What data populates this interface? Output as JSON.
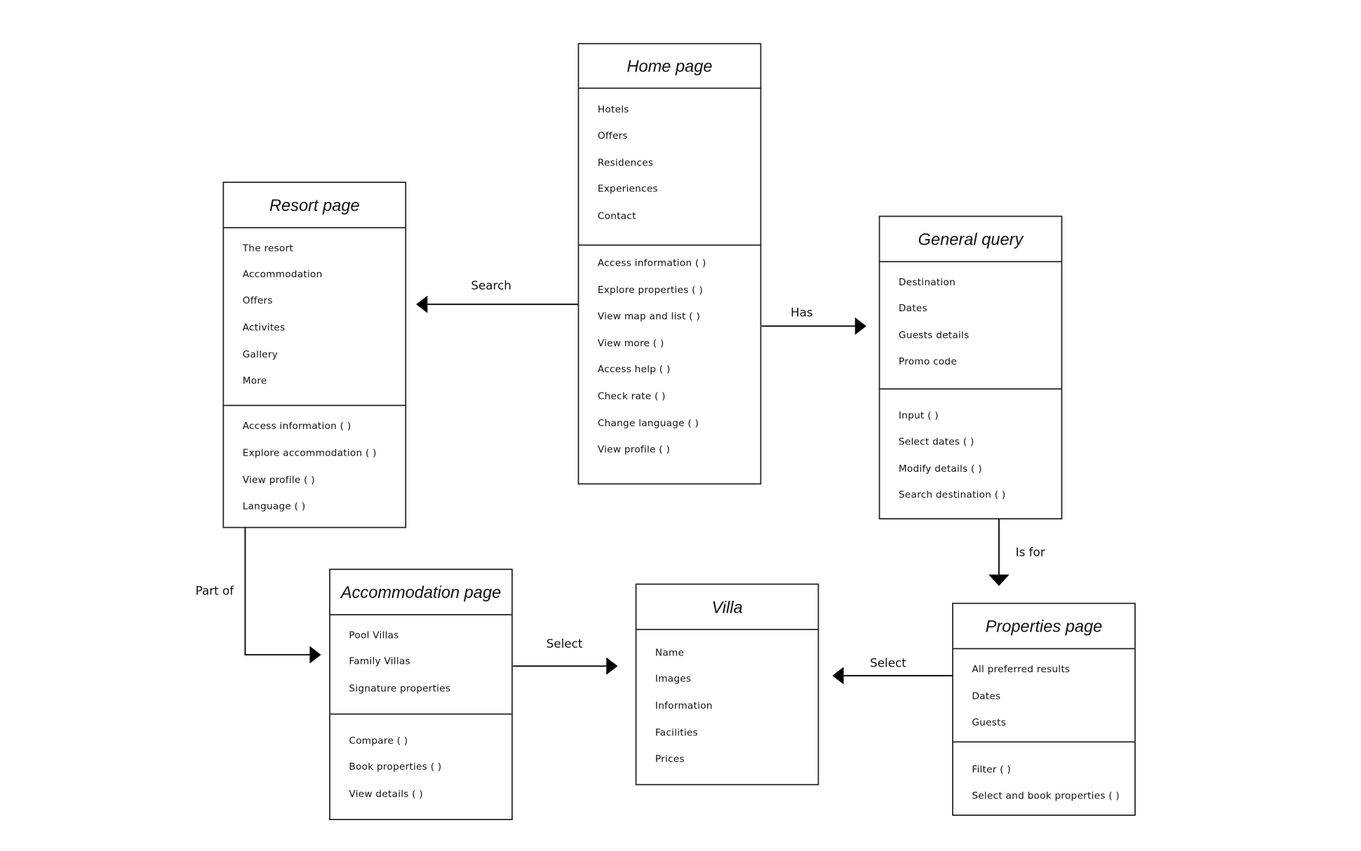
{
  "boxes": [
    {
      "id": "home-page",
      "title": "Home page",
      "attributes": [
        "Hotels",
        "Offers",
        "Residences",
        "Experiences",
        "Contact"
      ],
      "methods": [
        "Access information ( )",
        "Explore properties ( )",
        "View map and list ( )",
        "View more ( )",
        "Access help ( )",
        "Check rate ( )",
        "Change language ( )",
        "View profile ( )"
      ]
    },
    {
      "id": "resort-page",
      "title": "Resort page",
      "attributes": [
        "The resort",
        "Accommodation",
        "Offers",
        "Activites",
        "Gallery",
        "More"
      ],
      "methods": [
        "Access information ( )",
        "Explore accommodation ( )",
        "View profile ( )",
        "Language ( )"
      ]
    },
    {
      "id": "general-query",
      "title": "General query",
      "attributes": [
        "Destination",
        "Dates",
        "Guests details",
        "Promo code"
      ],
      "methods": [
        "Input ( )",
        "Select dates ( )",
        "Modify details ( )",
        "Search destination ( )"
      ]
    },
    {
      "id": "accommodation-page",
      "title": "Accommodation page",
      "attributes": [
        "Pool Villas",
        "Family Villas",
        "Signature properties"
      ],
      "methods": [
        "Compare ( )",
        "Book properties ( )",
        "View details ( )"
      ]
    },
    {
      "id": "villa",
      "title": "Villa",
      "attributes": [
        "Name",
        "Images",
        "Information",
        "Facilities",
        "Prices"
      ],
      "methods": []
    },
    {
      "id": "properties-page",
      "title": "Properties page",
      "attributes": [
        "All preferred results",
        "Dates",
        "Guests"
      ],
      "methods": [
        "Filter ( )",
        "Select and book properties ( )"
      ]
    }
  ],
  "relations": [
    {
      "from": "home-page",
      "to": "resort-page",
      "label": "Search"
    },
    {
      "from": "home-page",
      "to": "general-query",
      "label": "Has"
    },
    {
      "from": "general-query",
      "to": "properties-page",
      "label": "Is for"
    },
    {
      "from": "resort-page",
      "to": "accommodation-page",
      "label": "Part of"
    },
    {
      "from": "accommodation-page",
      "to": "villa",
      "label": "Select"
    },
    {
      "from": "properties-page",
      "to": "villa",
      "label": "Select"
    }
  ]
}
